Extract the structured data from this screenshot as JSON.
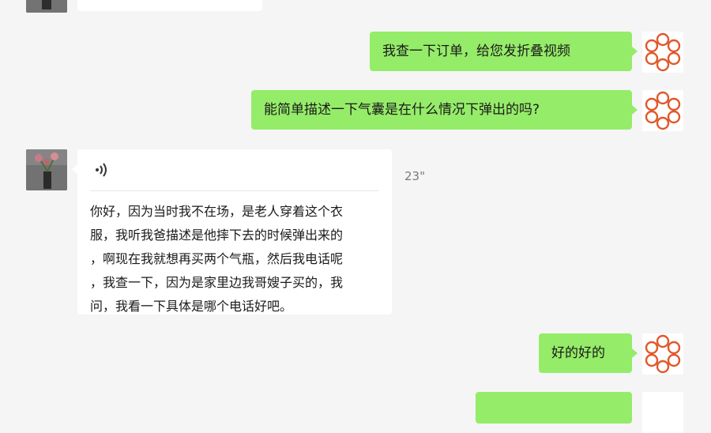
{
  "messages": {
    "m1": {
      "text": "我查一下订单，给您发折叠视频"
    },
    "m2": {
      "text": "能简单描述一下气囊是在什么情况下弹出的吗?"
    },
    "voice": {
      "icon": "voice-wave-icon",
      "duration": "23\"",
      "transcript": "你好，因为当时我不在场，是老人穿着这个衣\n服，我听我爸描述是他摔下去的时候弹出来的\n，啊现在我就想再买两个气瓶，然后我电话呢\n，我查一下，因为是家里边我哥嫂子买的，我\n问，我看一下具体是哪个电话好吧。"
    },
    "m3": {
      "text": "好的好的"
    }
  },
  "colors": {
    "outgoing_bubble": "#95ec69",
    "incoming_bubble": "#ffffff",
    "logo": "#e0582a",
    "background": "#f5f5f5"
  }
}
